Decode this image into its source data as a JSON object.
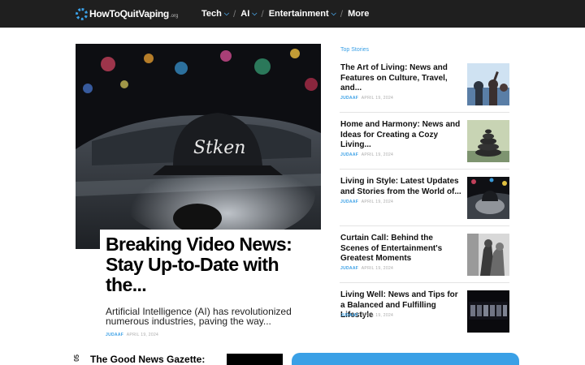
{
  "header": {
    "logo": {
      "text": "HowToQuitVaping",
      "tld": ".org"
    },
    "nav": [
      {
        "label": "Tech",
        "has_dropdown": true
      },
      {
        "label": "AI",
        "has_dropdown": true
      },
      {
        "label": "Entertainment",
        "has_dropdown": true
      },
      {
        "label": "More",
        "has_dropdown": false
      }
    ],
    "icons": {
      "dropdown": "chevron-down-icon"
    }
  },
  "hero": {
    "image_caption_text": "Stken",
    "title": "Breaking Video News: Stay Up-to-Date with the...",
    "excerpt": "Artificial Intelligence (AI) has revolutionized numerous industries, paving the way...",
    "author": "JUDAAF",
    "date": "APRIL 19, 2024"
  },
  "top_stories": {
    "heading": "Top Stories",
    "items": [
      {
        "title": "The Art of Living: News and Features on Culture, Travel, and...",
        "author": "JUDAAF",
        "date": "APRIL 19, 2024"
      },
      {
        "title": "Home and Harmony: News and Ideas for Creating a Cozy Living...",
        "author": "JUDAAF",
        "date": "APRIL 19, 2024"
      },
      {
        "title": "Living in Style: Latest Updates and Stories from the World of...",
        "author": "JUDAAF",
        "date": "APRIL 19, 2024"
      },
      {
        "title": "Curtain Call: Behind the Scenes of Entertainment's Greatest Moments",
        "author": "JUDAAF",
        "date": "APRIL 19, 2024"
      },
      {
        "title": "Living Well: News and Tips for a Balanced and Fulfilling Lifestyle",
        "author": "JUDAAF",
        "date": "APRIL 19, 2024"
      }
    ]
  },
  "bottom": {
    "vertical_label": "05",
    "title": "The Good News Gazette:"
  },
  "colors": {
    "accent": "#3aa0e6",
    "header_bg": "#1f1f1f",
    "meta_gray": "#aaaaaa"
  }
}
